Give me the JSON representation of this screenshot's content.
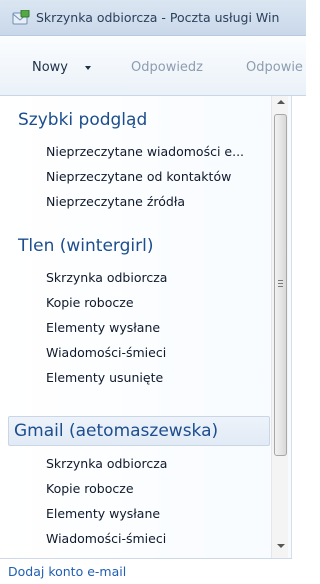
{
  "window": {
    "title": "Skrzynka odbiorcza - Poczta usługi Win",
    "icon": "mail-app-icon"
  },
  "toolbar": {
    "new_label": "Nowy",
    "reply_label": "Odpowiedz",
    "reply_all_label": "Odpowie"
  },
  "folder_pane": {
    "quick_view": {
      "header": "Szybki podgląd",
      "items": [
        "Nieprzeczytane wiadomości e...",
        "Nieprzeczytane od kontaktów",
        "Nieprzeczytane źródła"
      ]
    },
    "account_tlen": {
      "header": "Tlen (wintergirl)",
      "items": [
        "Skrzynka odbiorcza",
        "Kopie robocze",
        "Elementy wysłane",
        "Wiadomości-śmieci",
        "Elementy usunięte"
      ]
    },
    "account_gmail": {
      "header": "Gmail (aetomaszewska)",
      "items": [
        "Skrzynka odbiorcza",
        "Kopie robocze",
        "Elementy wysłane",
        "Wiadomości-śmieci"
      ]
    },
    "add_account_label": "Dodaj konto e-mail"
  },
  "colors": {
    "header_blue": "#1c4e8e",
    "link_blue": "#1f5fb3",
    "title_bar": "#dbe6f2"
  }
}
